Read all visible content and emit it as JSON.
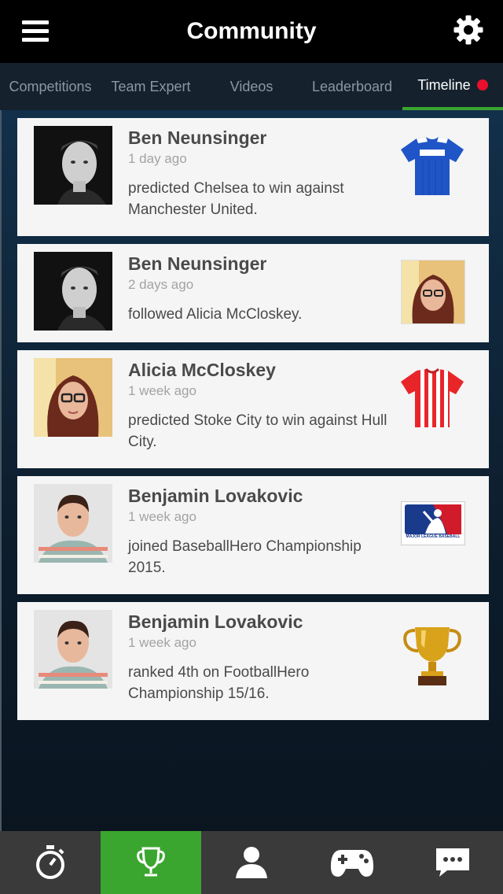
{
  "header": {
    "title": "Community",
    "menu_icon": "hamburger-menu-icon",
    "settings_icon": "gear-icon"
  },
  "tabs": [
    {
      "label": "Competitions",
      "active": false
    },
    {
      "label": "Team Expert",
      "active": false
    },
    {
      "label": "Videos",
      "active": false
    },
    {
      "label": "Leaderboard",
      "active": false
    },
    {
      "label": "Timeline",
      "active": true,
      "badge": "red-dot"
    }
  ],
  "timeline": [
    {
      "name": "Ben Neunsinger",
      "time": "1 day ago",
      "action": "predicted Chelsea to win against Manchester United.",
      "thumb": "blue-jersey-icon"
    },
    {
      "name": "Ben Neunsinger",
      "time": "2 days ago",
      "action": "followed Alicia McCloskey.",
      "thumb": "alicia-avatar"
    },
    {
      "name": "Alicia McCloskey",
      "time": "1 week ago",
      "action": "predicted Stoke City to win against Hull City.",
      "thumb": "red-striped-jersey-icon"
    },
    {
      "name": "Benjamin Lovakovic",
      "time": "1 week ago",
      "action": "joined BaseballHero Championship 2015.",
      "thumb": "mlb-logo",
      "thumb_caption": "MAJOR LEAGUE BASEBALL"
    },
    {
      "name": "Benjamin Lovakovic",
      "time": "1 week ago",
      "action": "ranked 4th on FootballHero Championship 15/16.",
      "thumb": "trophy-icon"
    }
  ],
  "bottom_nav": [
    {
      "icon": "stopwatch-icon",
      "active": false
    },
    {
      "icon": "trophy-icon",
      "active": true
    },
    {
      "icon": "person-icon",
      "active": false
    },
    {
      "icon": "gamepad-icon",
      "active": false
    },
    {
      "icon": "chat-bubble-icon",
      "active": false
    }
  ],
  "colors": {
    "accent": "#3aa62f",
    "badge": "#e8102c",
    "header_bg": "#000000",
    "tab_bg": "#15222e"
  }
}
